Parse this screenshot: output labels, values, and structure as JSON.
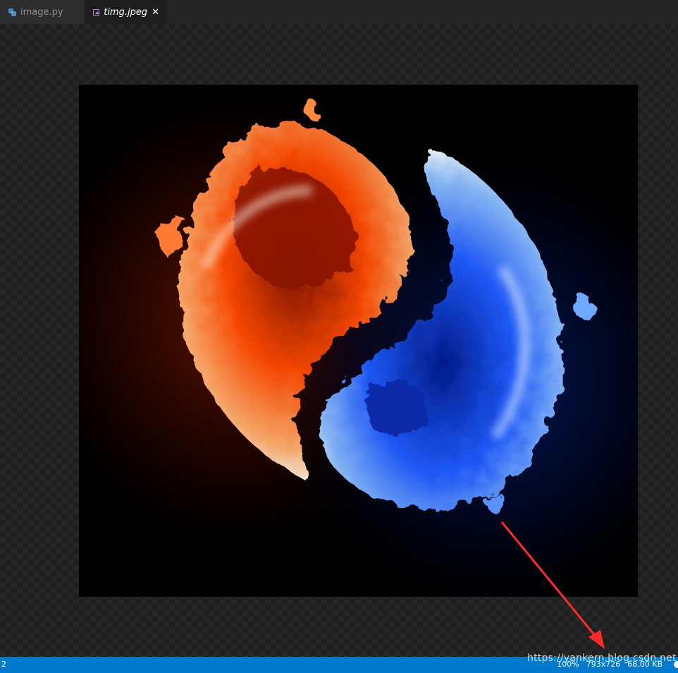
{
  "tabs": [
    {
      "label": "image.py",
      "icon": "python-file-icon",
      "active": false
    },
    {
      "label": "timg.jpeg",
      "icon": "image-file-icon",
      "active": true,
      "close_glyph": "✕"
    }
  ],
  "preview": {
    "image_description_icon": "yin-yang-fire-image",
    "colors": {
      "fire": "#ff5a10",
      "water": "#2a6bff",
      "background": "#000000"
    }
  },
  "status": {
    "left": "2",
    "zoom": "100%",
    "dimensions": "793x726",
    "size": "68.00 KB"
  },
  "watermark": "https://yankern.blog.csdn.net",
  "colors": {
    "statusbar": "#007acc",
    "arrow": "#ff2a2a",
    "tab_active": "#1e1e1e",
    "tab_inactive": "#2d2d2d"
  }
}
